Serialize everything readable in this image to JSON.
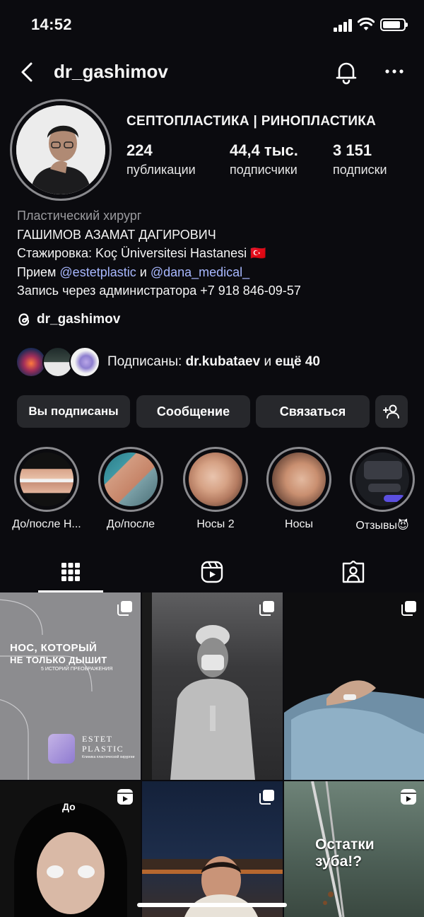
{
  "status_bar": {
    "time": "14:52"
  },
  "header": {
    "username": "dr_gashimov"
  },
  "profile": {
    "name": "СЕПТОПЛАСТИКА | РИНОПЛАСТИКА",
    "stats": [
      {
        "value": "224",
        "label": "публикации"
      },
      {
        "value": "44,4 тыс.",
        "label": "подписчики"
      },
      {
        "value": "3 151",
        "label": "подписки"
      }
    ],
    "bio": {
      "category": "Пластический хирург",
      "line1": "ГАШИМОВ АЗАМАТ ДАГИРОВИЧ",
      "line2_prefix": "Стажировка: Koç Üniversitesi Hastanesi",
      "line2_flag": "🇹🇷",
      "line3_prefix": "Прием",
      "line3_mention1": "@estetplastic",
      "line3_and": "и",
      "line3_mention2": "@dana_medical_",
      "line4": "Запись через администратора +7 918 846-09-57"
    },
    "threads_handle": "dr_gashimov",
    "followed_by": {
      "prefix": "Подписаны:",
      "user": "dr.kubataev",
      "middle": "и",
      "more": "ещё 40"
    }
  },
  "actions": {
    "following": "Вы подписаны",
    "message": "Сообщение",
    "contact": "Связаться"
  },
  "highlights": [
    {
      "label": "До/после Н..."
    },
    {
      "label": "До/после"
    },
    {
      "label": "Носы 2"
    },
    {
      "label": "Носы"
    },
    {
      "label": "Отзывы😈"
    }
  ],
  "posts": {
    "post1": {
      "headline1": "НОС, КОТОРЫЙ",
      "headline2": "НЕ ТОЛЬКО ДЫШИТ",
      "subline": "5 ИСТОРИЙ ПРЕОБРАЖЕНИЯ",
      "brand1": "ESTET",
      "brand2": "PLASTIC",
      "brand_sub": "Клиника пластической хирургии"
    },
    "post4": {
      "caption": "До"
    },
    "post6": {
      "caption": "Остатки зуба!?"
    }
  },
  "colors": {
    "background": "#0b0b0f",
    "button": "#27282c",
    "mention": "#a8b8ff",
    "muted": "#9a9a9e"
  }
}
